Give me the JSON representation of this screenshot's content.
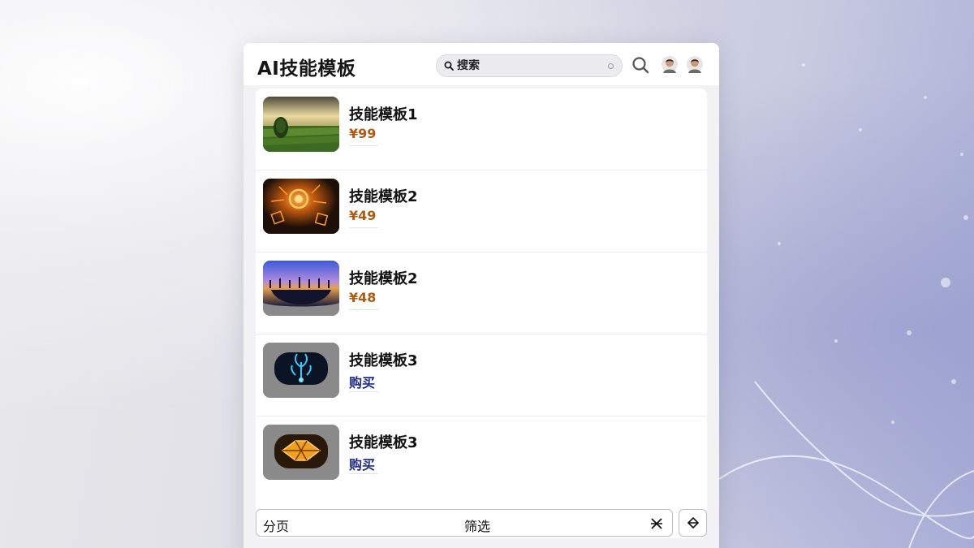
{
  "app": {
    "title": "AI技能模板"
  },
  "search": {
    "placeholder": "搜索"
  },
  "header": {
    "icons": [
      "search-icon",
      "user-avatar-icon",
      "user-avatar-icon"
    ]
  },
  "items": [
    {
      "name": "技能模板1",
      "price": "¥99",
      "image": "landscape-field-thumbnail"
    },
    {
      "name": "技能模板2",
      "price": "¥49",
      "image": "glowing-orb-thumbnail"
    },
    {
      "name": "技能模板2",
      "price": "¥48",
      "image": "sunset-trees-thumbnail"
    },
    {
      "name": "技能模板3",
      "price": "购买",
      "image": "blue-neon-sprout-thumbnail"
    },
    {
      "name": "技能模板3",
      "price": "购买",
      "image": "orange-neon-shape-thumbnail"
    }
  ],
  "footer": {
    "pagination_label": "分页",
    "filter_label": "筛选",
    "icons": [
      "close-x-icon",
      "collapse-icon"
    ]
  },
  "colors": {
    "price": "#b25a12",
    "buy": "#1f2a8a",
    "panel_bg": "#f2f2f4"
  }
}
